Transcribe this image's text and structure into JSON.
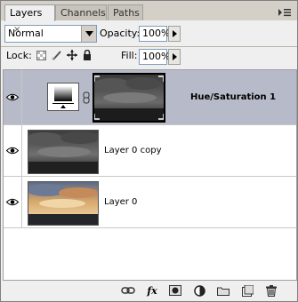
{
  "tabs": [
    {
      "label": "Layers",
      "close": "×"
    },
    {
      "label": "Channels"
    },
    {
      "label": "Paths"
    }
  ],
  "blend_mode": "Normal",
  "opacity": {
    "label": "Opacity:",
    "value": "100%"
  },
  "lock": {
    "label": "Lock:"
  },
  "fill": {
    "label": "Fill:",
    "value": "100%"
  },
  "layers": [
    {
      "name": "Hue/Saturation 1",
      "visible": true,
      "selected": true,
      "type": "adjustment"
    },
    {
      "name": "Layer 0 copy",
      "visible": true,
      "selected": false,
      "type": "pixel"
    },
    {
      "name": "Layer 0",
      "visible": true,
      "selected": false,
      "type": "pixel"
    }
  ],
  "footer": {
    "fx_label": "fx",
    "buttons": [
      "link-icon",
      "fx-icon",
      "mask-icon",
      "adjustment-icon",
      "folder-icon",
      "new-layer-icon",
      "trash-icon"
    ]
  },
  "colors": {
    "selected_row": "#b7bac8",
    "panel_bg": "#efefef",
    "chrome": "#d4d0c8"
  }
}
